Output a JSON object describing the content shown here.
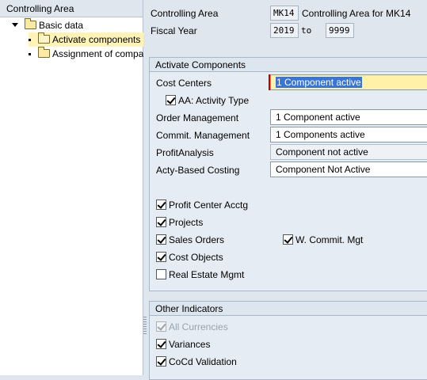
{
  "tree": {
    "header": "Controlling Area",
    "root": "Basic data",
    "items": [
      "Activate components",
      "Assignment of company codes"
    ]
  },
  "header": {
    "controlling_area_label": "Controlling Area",
    "controlling_area_value": "MK14",
    "controlling_area_desc": "Controlling Area for MK14",
    "fiscal_year_label": "Fiscal Year",
    "fiscal_year_from": "2019",
    "to_label": "to",
    "fiscal_year_to": "9999"
  },
  "activate": {
    "title": "Activate Components",
    "cost_centers_label": "Cost Centers",
    "cost_centers_value": "1 Component active",
    "aa_activity_type": "AA: Activity Type",
    "order_mgmt_label": "Order Management",
    "order_mgmt_value": "1 Component active",
    "commit_mgmt_label": "Commit. Management",
    "commit_mgmt_value": "1 Components active",
    "profit_analysis_label": "ProfitAnalysis",
    "profit_analysis_value": "Component not active",
    "acty_costing_label": "Acty-Based Costing",
    "acty_costing_value": "Component Not Active",
    "profit_center": "Profit Center Acctg",
    "projects": "Projects",
    "sales_orders": "Sales Orders",
    "w_commit_mgt": "W. Commit. Mgt",
    "cost_objects": "Cost Objects",
    "real_estate": "Real Estate Mgmt"
  },
  "other": {
    "title": "Other Indicators",
    "all_currencies": "All Currencies",
    "variances": "Variances",
    "cocd_validation": "CoCd Validation"
  }
}
